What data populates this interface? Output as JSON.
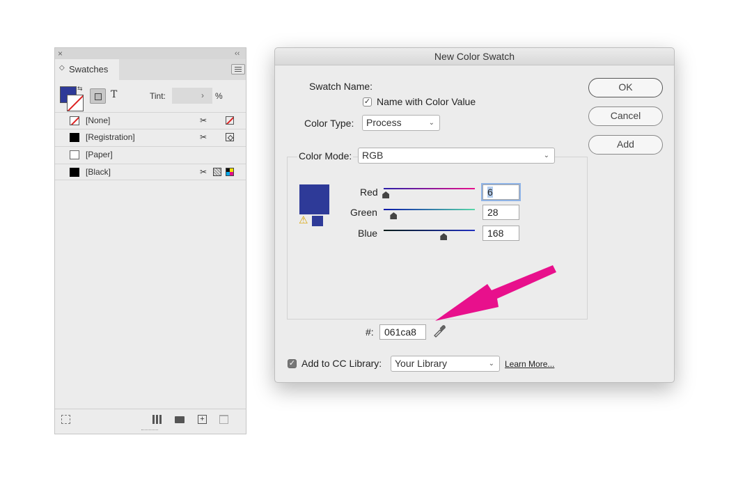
{
  "swatches_panel": {
    "close_glyph": "×",
    "collapse_glyph": "‹‹",
    "tab_arrow": "◇",
    "tab_label": "Swatches",
    "swap_glyph": "⇆",
    "text_glyph": "T",
    "tint_label": "Tint:",
    "tint_value": "",
    "tint_arrow": "›",
    "tint_unit": "%",
    "fill_color": "#2e3a98",
    "rows": [
      {
        "name": "[None]",
        "chip": "none",
        "icons": [
          "lock-x-icon",
          "none-box-icon"
        ]
      },
      {
        "name": "[Registration]",
        "chip": "#000000",
        "icons": [
          "lock-x-icon",
          "registration-icon"
        ]
      },
      {
        "name": "[Paper]",
        "chip": "#ffffff",
        "icons": []
      },
      {
        "name": "[Black]",
        "chip": "#000000",
        "icons": [
          "lock-x-icon",
          "process-icon",
          "cmyk-icon"
        ]
      }
    ],
    "row_icon_glyph": "✂"
  },
  "dialog": {
    "title": "New Color Swatch",
    "swatch_name_label": "Swatch Name:",
    "name_with_color_value_label": "Name with Color Value",
    "name_with_color_value_checked": true,
    "checkmark": "✓",
    "color_type_label": "Color Type:",
    "color_type_value": "Process",
    "color_mode_label": "Color Mode:",
    "color_mode_value": "RGB",
    "chevron": "⌄",
    "preview_color": "#2e3a98",
    "gamut_warning_glyph": "⚠",
    "sliders": [
      {
        "label": "Red",
        "value": "6",
        "fraction": 0.024
      },
      {
        "label": "Green",
        "value": "28",
        "fraction": 0.11
      },
      {
        "label": "Blue",
        "value": "168",
        "fraction": 0.659
      }
    ],
    "hex_label": "#:",
    "hex_value": "061ca8",
    "eyedropper": "eyedropper-icon",
    "ok_label": "OK",
    "cancel_label": "Cancel",
    "add_label": "Add",
    "add_to_cc_label": "Add to CC Library:",
    "add_to_cc_checked": true,
    "library_value": "Your Library",
    "learn_more_label": "Learn More..."
  },
  "annotation_arrow_color": "#e8108c"
}
